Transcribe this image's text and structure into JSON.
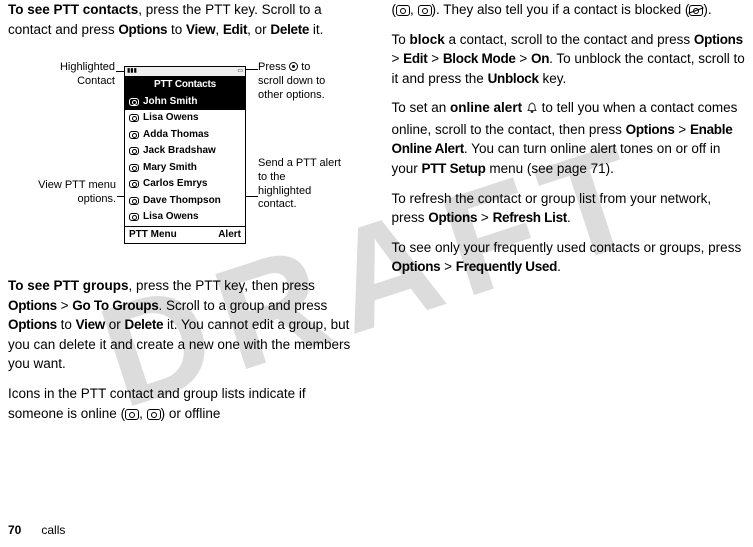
{
  "watermark": "DRAFT",
  "left": {
    "p1_prefix_bold": "To see PTT contacts",
    "p1_rest_a": ", press the PTT key. Scroll to a contact and press ",
    "p1_options": "Options",
    "p1_to": " to ",
    "p1_view": "View",
    "p1_comma": ", ",
    "p1_edit": "Edit",
    "p1_comma2": ", or ",
    "p1_delete": "Delete",
    "p1_end": " it.",
    "diagram": {
      "highlighted_label": "Highlighted\nContact",
      "view_menu_label": "View PTT menu\noptions.",
      "scroll_label_a": "Press ",
      "scroll_label_b": " to\nscroll down to\nother options.",
      "send_alert_label": "Send a PTT alert\nto the\nhighlighted\ncontact.",
      "phone": {
        "title": "PTT Contacts",
        "contacts": [
          "John Smith",
          "Lisa Owens",
          "Adda Thomas",
          "Jack Bradshaw",
          "Mary Smith",
          "Carlos Emrys",
          "Dave Thompson",
          "Lisa Owens"
        ],
        "highlight_index": 0,
        "soft_left": "PTT Menu",
        "soft_right": "Alert"
      }
    },
    "p2_prefix_bold": "To see PTT groups",
    "p2_a": ", press the PTT key, then press ",
    "p2_options": "Options",
    "p2_gt": " > ",
    "p2_goto": "Go To Groups",
    "p2_b": ". Scroll to a group and press ",
    "p2_options2": "Options",
    "p2_to": " to ",
    "p2_view": "View",
    "p2_or": " or ",
    "p2_delete": "Delete",
    "p2_c": " it. You cannot edit a group, but you can delete it and create a new one with the members you want.",
    "p3": "Icons in the PTT contact and group lists indicate if someone is online (",
    "p3_b": ", ",
    "p3_c": ") or offline"
  },
  "right": {
    "p1_a": "(",
    "p1_b": ", ",
    "p1_c": "). They also tell you if a contact is blocked (",
    "p1_d": ").",
    "p2_a": "To ",
    "p2_block": "block",
    "p2_b": " a contact, scroll to the contact and press ",
    "p2_options": "Options",
    "p2_gt": " > ",
    "p2_edit": "Edit",
    "p2_blockmode": "Block Mode",
    "p2_on": "On",
    "p2_c": ". To unblock the contact, scroll to it and press the ",
    "p2_unblock": "Unblock",
    "p2_key": " key.",
    "p3_a": "To set an ",
    "p3_online_alert": "online alert",
    "p3_b": " to tell you when a contact comes online, scroll to the contact, then press ",
    "p3_options": "Options",
    "p3_gt": " > ",
    "p3_enable": "Enable Online Alert",
    "p3_c": ". You can turn online alert tones on or off in your ",
    "p3_pttsetup": "PTT Setup",
    "p3_d": " menu (see page 71).",
    "p4_a": "To refresh the contact or group list from your network, press ",
    "p4_options": "Options",
    "p4_gt": " > ",
    "p4_refresh": "Refresh List",
    "p4_b": ".",
    "p5_a": "To see only your frequently used contacts or groups, press ",
    "p5_options": "Options",
    "p5_gt": " > ",
    "p5_freq": "Frequently Used",
    "p5_b": "."
  },
  "footer": {
    "page": "70",
    "section": "calls"
  }
}
